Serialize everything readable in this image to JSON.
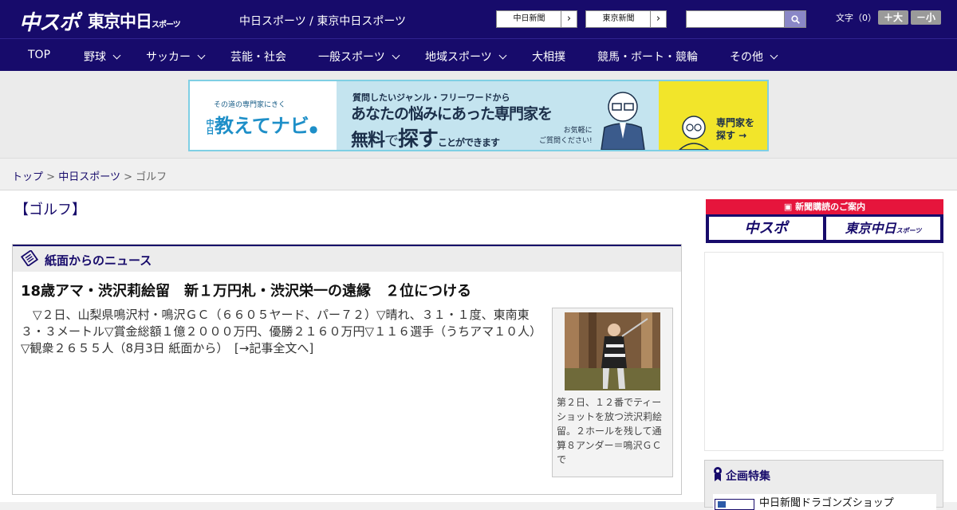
{
  "header": {
    "logo_chuspo": "中スポ",
    "logo_tokyo": "東京中日",
    "logo_tokyo_small": "スポーツ",
    "site_title": "中日スポーツ / 東京中日スポーツ",
    "paper_buttons": [
      "中日新聞",
      "東京新聞"
    ],
    "search": {
      "placeholder": "",
      "value": ""
    },
    "font_size": {
      "label": "文字（0）",
      "larger": "＋大",
      "smaller": "－小"
    }
  },
  "nav": {
    "items": [
      {
        "label": "TOP",
        "dropdown": false
      },
      {
        "label": "野球",
        "dropdown": true
      },
      {
        "label": "サッカー",
        "dropdown": true
      },
      {
        "label": "芸能・社会",
        "dropdown": false
      },
      {
        "label": "一般スポーツ",
        "dropdown": true
      },
      {
        "label": "地域スポーツ",
        "dropdown": true
      },
      {
        "label": "大相撲",
        "dropdown": false
      },
      {
        "label": "競馬・ボート・競輪",
        "dropdown": false
      },
      {
        "label": "その他",
        "dropdown": true
      }
    ]
  },
  "ad": {
    "small_text": "その道の専門家にきく",
    "brand_prefix": "中日",
    "brand": "教えてナビ",
    "line1": "質問したいジャンル・フリーワードから",
    "line2": "あなたの悩みにあった専門家を",
    "line3_a": "無料",
    "line3_b": "で",
    "line3_c": "探す",
    "line3_d": "ことができます",
    "note1": "お気軽に",
    "note2": "ご質問ください!",
    "cta1": "専門家を",
    "cta2": "探す →"
  },
  "breadcrumb": {
    "items": [
      "トップ",
      "中日スポーツ",
      "ゴルフ"
    ],
    "sep": ">"
  },
  "page": {
    "title": "【ゴルフ】"
  },
  "news": {
    "section_label": "紙面からのニュース",
    "article_title": "18歳アマ・渋沢莉絵留　新１万円札・渋沢栄一の遠縁　２位につける",
    "article_body": "▽２日、山梨県鳴沢村・鳴沢ＧＣ（６６０５ヤード、パー７２）▽晴れ、３１・１度、東南東３・３メートル▽賞金総額１億２０００万円、優勝２１６０万円▽１１６選手（うちアマ１０人）▽観衆２６５５人（8月3日 紙面から）",
    "read_more": "[→記事全文へ]",
    "photo_caption": "第２日、１２番でティーショットを放つ渋沢莉絵留。２ホールを残して通算８アンダー＝鳴沢ＧＣで"
  },
  "sidebar": {
    "subscribe_header": "新聞購読のご案内",
    "subscribe_buttons": [
      "中スポ",
      "東京中日"
    ],
    "subscribe_button_small": "スポーツ",
    "special_header": "企画特集",
    "special_item": "中日新聞ドラゴンズショップ"
  },
  "colors": {
    "brand_navy": "#170b6b",
    "subscribe_red": "#e6153c",
    "ad_border": "#7fcfe4"
  }
}
